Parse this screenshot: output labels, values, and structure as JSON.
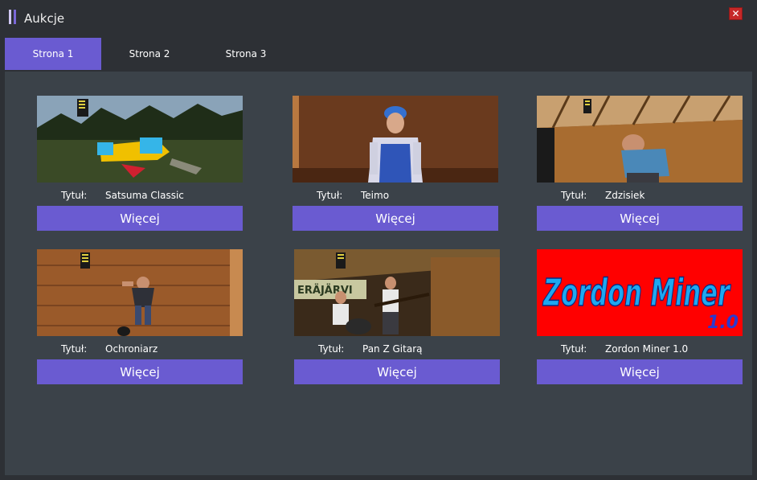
{
  "window": {
    "title": "Aukcje",
    "close_icon": "close-icon",
    "accent_color": "#6a5bd1"
  },
  "tabs": [
    {
      "label": "Strona 1",
      "active": true
    },
    {
      "label": "Strona 2",
      "active": false
    },
    {
      "label": "Strona 3",
      "active": false
    }
  ],
  "cards": [
    {
      "label": "Tytuł:",
      "title": "Satsuma Classic",
      "button": "Więcej"
    },
    {
      "label": "Tytuł:",
      "title": "Teimo",
      "button": "Więcej"
    },
    {
      "label": "Tytuł:",
      "title": "Zdzisiek",
      "button": "Więcej"
    },
    {
      "label": "Tytuł:",
      "title": "Ochroniarz",
      "button": "Więcej"
    },
    {
      "label": "Tytuł:",
      "title": "Pan Z Gitarą",
      "button": "Więcej"
    },
    {
      "label": "Tytuł:",
      "title": "Zordon Miner 1.0",
      "button": "Więcej",
      "image_text": "Zordon Miner",
      "image_badge": "1.0"
    }
  ]
}
